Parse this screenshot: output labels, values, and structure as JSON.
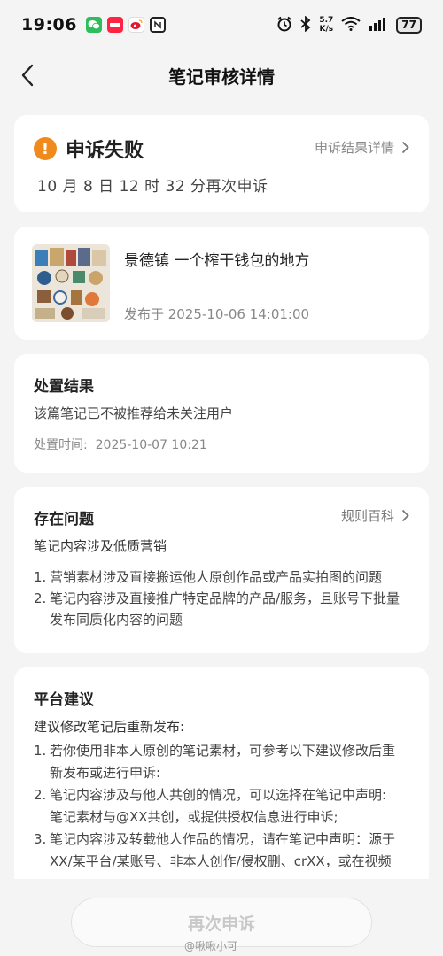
{
  "status_bar": {
    "time": "19:06",
    "net_speed_top": "5.7",
    "net_speed_bottom": "K/s",
    "battery": "77"
  },
  "nav": {
    "title": "笔记审核详情"
  },
  "appeal": {
    "status": "申诉失败",
    "detail_link": "申诉结果详情",
    "time_text": "10 月 8 日 12 时 32 分再次申诉"
  },
  "note": {
    "title": "景德镇 一个榨干钱包的地方",
    "published": "发布于 2025-10-06 14:01:00"
  },
  "result": {
    "title": "处置结果",
    "text": "该篇笔记已不被推荐给未关注用户",
    "time_label": "处置时间:",
    "time_value": "2025-10-07 10:21"
  },
  "issues": {
    "title": "存在问题",
    "rules_link": "规则百科",
    "summary": "笔记内容涉及低质营销",
    "items": [
      {
        "num": "1.",
        "lines": [
          "营销素材涉及直接搬运他人原创作品或产品实拍图的问题"
        ]
      },
      {
        "num": "2.",
        "lines": [
          "笔记内容涉及直接推广特定品牌的产品/服务，且账号下批量",
          "发布同质化内容的问题"
        ]
      }
    ]
  },
  "advice": {
    "title": "平台建议",
    "intro": "建议修改笔记后重新发布:",
    "items": [
      {
        "num": "1.",
        "lines": [
          "若你使用非本人原创的笔记素材，可参考以下建议修改后重",
          "新发布或进行申诉:"
        ]
      },
      {
        "num": "2.",
        "lines": [
          "笔记内容涉及与他人共创的情况，可以选择在笔记中声明:",
          "笔记素材与@XX共创，或提供授权信息进行申诉;"
        ]
      },
      {
        "num": "3.",
        "lines": [
          "笔记内容涉及转载他人作品的情况，请在笔记中声明：源于",
          "XX/某平台/某账号、非本人创作/侵权删、crXX，或在视频"
        ]
      }
    ]
  },
  "bottom": {
    "reappeal_button": "再次申诉",
    "watermark": "@啾啾小可_"
  },
  "colors": {
    "accent_orange": "#f08a1c",
    "background": "#f4f4f5",
    "card": "#ffffff"
  }
}
